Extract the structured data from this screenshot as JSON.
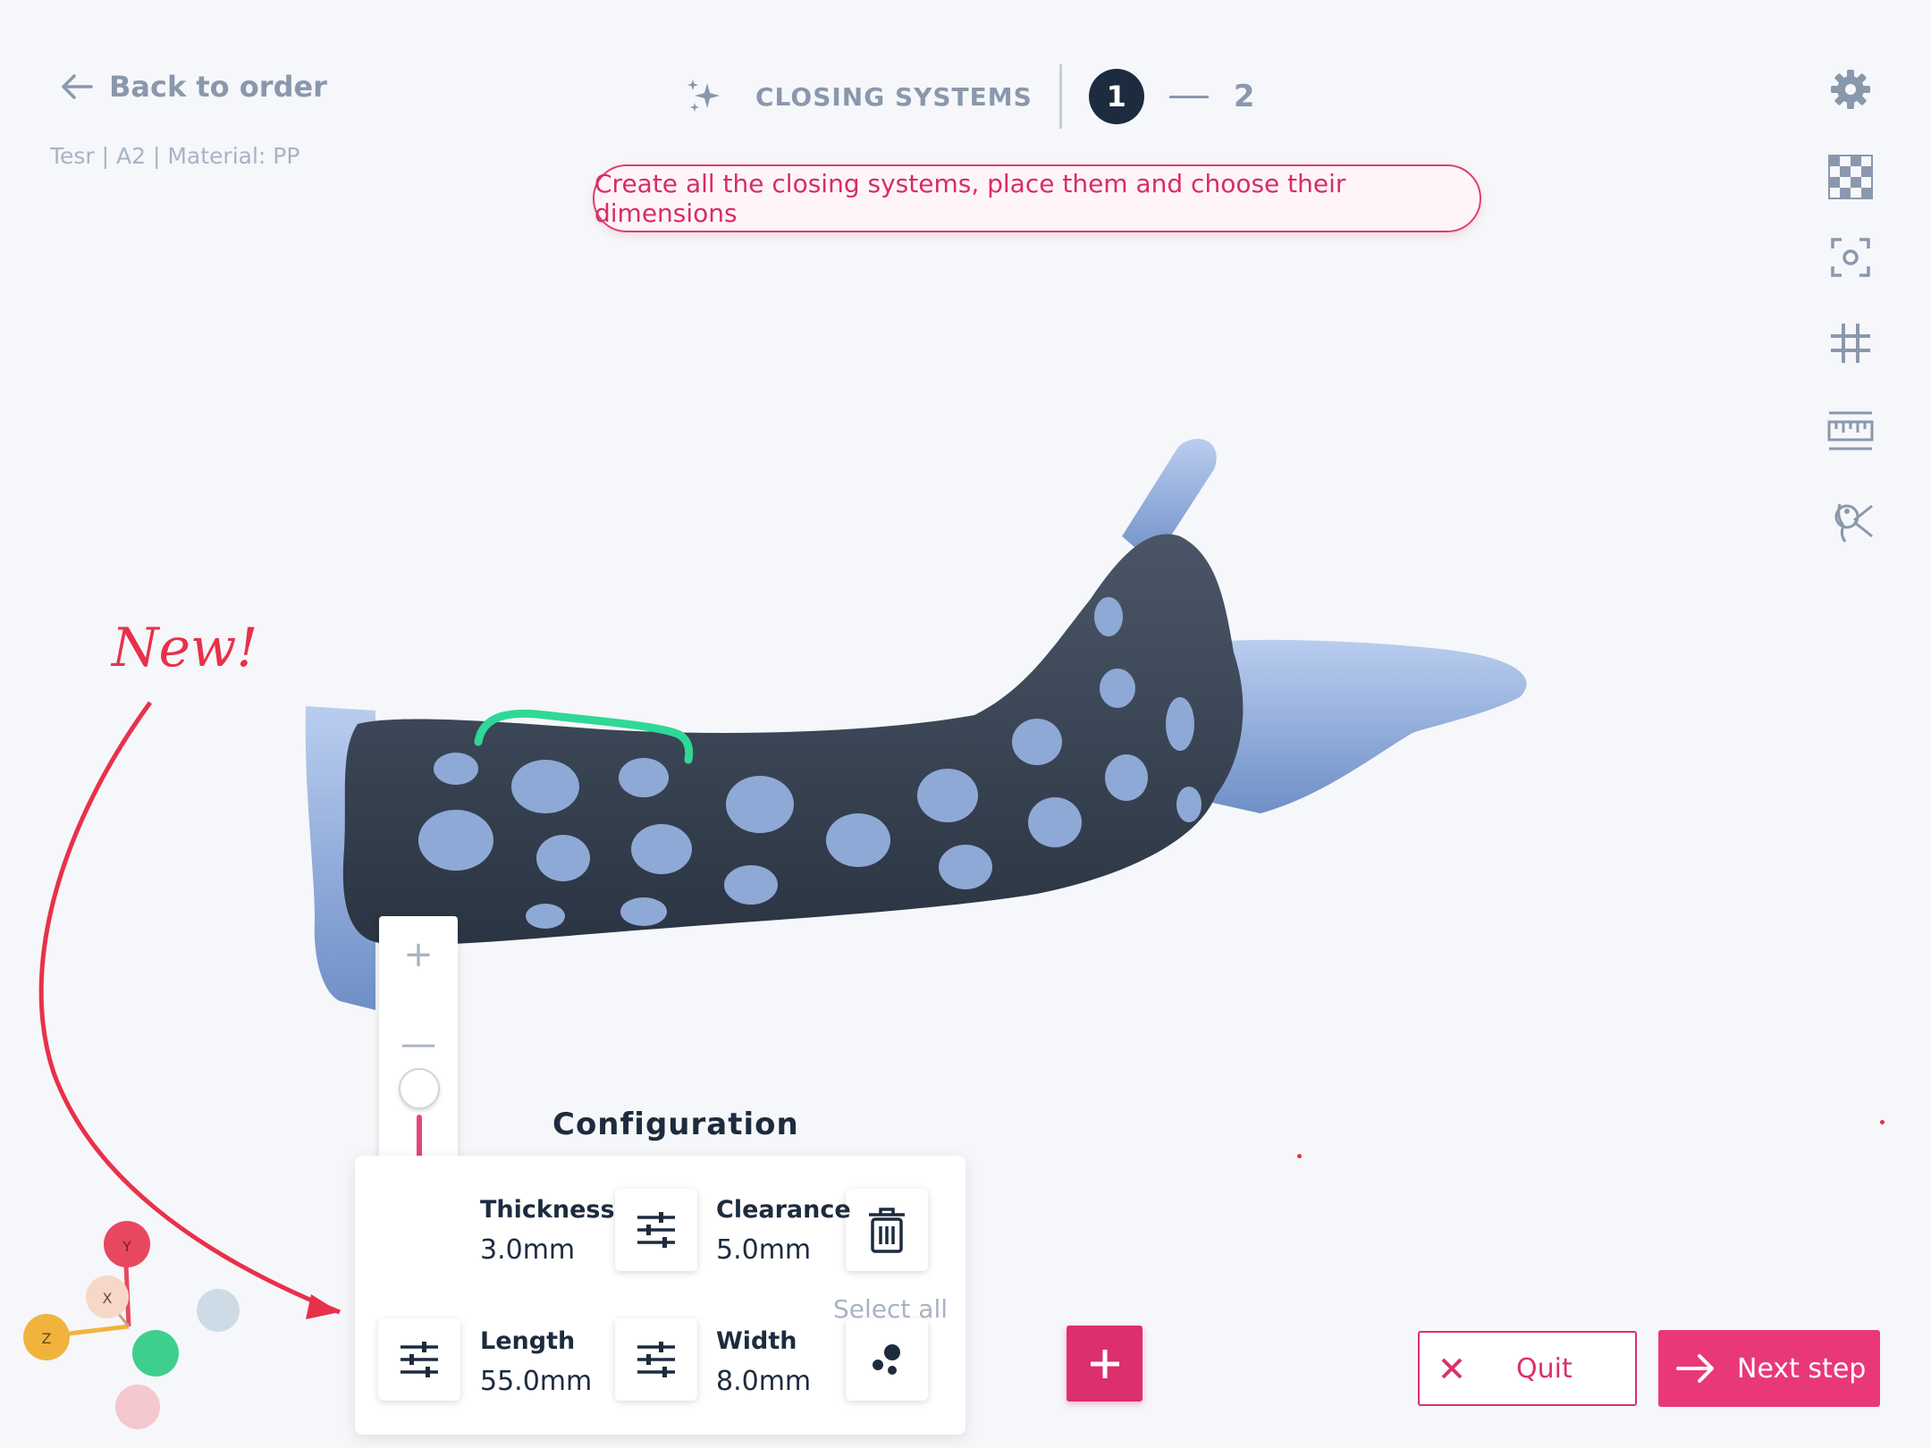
{
  "header": {
    "back_label": "Back to order",
    "meta": "Tesr | A2 | Material: PP",
    "section_title": "CLOSING SYSTEMS",
    "step_current": "1",
    "step_next": "2",
    "hint": "Create all the closing systems, place them and choose their dimensions"
  },
  "toolbar": {
    "icons": [
      "gear-icon",
      "checker-icon",
      "focus-icon",
      "grid-icon",
      "ruler-icon",
      "body-cut-icon"
    ]
  },
  "annotation": {
    "new_label": "New!"
  },
  "zoom": {
    "plus": "+",
    "minus": "—",
    "level": 0.75
  },
  "config": {
    "title": "Configuration",
    "thickness_label": "Thickness",
    "thickness_value": "3.0mm",
    "clearance_label": "Clearance",
    "clearance_value": "5.0mm",
    "length_label": "Length",
    "length_value": "55.0mm",
    "width_label": "Width",
    "width_value": "8.0mm",
    "select_all": "Select all"
  },
  "axes": {
    "y": "Y",
    "x": "X",
    "z": "Z"
  },
  "actions": {
    "add": "+",
    "quit": "Quit",
    "next": "Next step"
  },
  "colors": {
    "accent": "#dc2f6d",
    "navy": "#1d2b3f",
    "muted": "#8a98ad",
    "splint": "#3a4555",
    "arm": "#9bb4dc",
    "strap": "#2fd896"
  }
}
